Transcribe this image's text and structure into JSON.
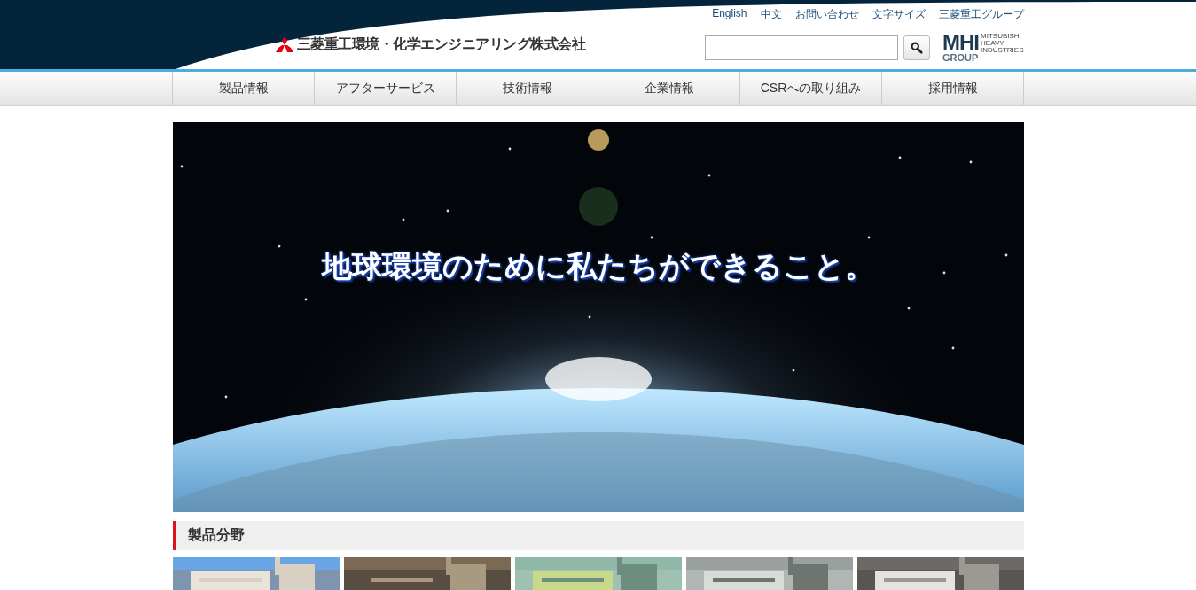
{
  "header": {
    "company_name": "三菱重工環境・化学エンジニアリング株式会社",
    "utility_links": [
      "English",
      "中文",
      "お問い合わせ",
      "文字サイズ",
      "三菱重工グループ"
    ],
    "group_logo": {
      "mark": "MHI",
      "sub": "GROUP",
      "lines": [
        "MITSUBISHI",
        "HEAVY",
        "INDUSTRIES"
      ]
    }
  },
  "nav": [
    "製品情報",
    "アフターサービス",
    "技術情報",
    "企業情報",
    "CSRへの取り組み",
    "採用情報"
  ],
  "hero": {
    "kind": "picture",
    "headline": "地球環境のために私たちができること。"
  },
  "section": {
    "title": "製品分野"
  }
}
